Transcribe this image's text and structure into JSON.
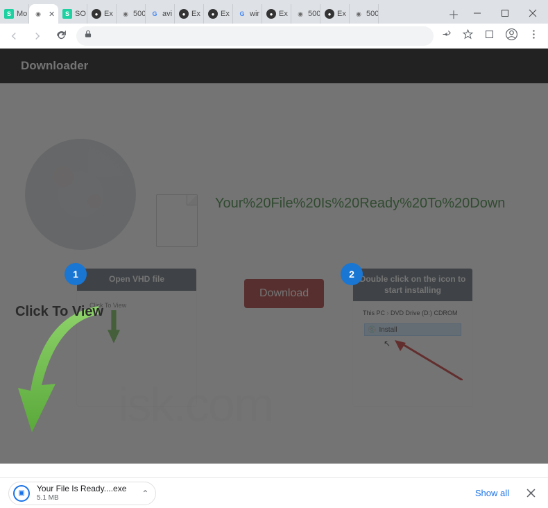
{
  "window": {
    "tabs": [
      {
        "favtype": "s",
        "label": "Mo"
      },
      {
        "favtype": "globe",
        "label": "",
        "active": true
      },
      {
        "favtype": "s",
        "label": "SO"
      },
      {
        "favtype": "ex",
        "label": "Ex"
      },
      {
        "favtype": "globe",
        "label": "500"
      },
      {
        "favtype": "g",
        "label": "avi"
      },
      {
        "favtype": "ex",
        "label": "Ex"
      },
      {
        "favtype": "ex",
        "label": "Ex"
      },
      {
        "favtype": "g",
        "label": "wir"
      },
      {
        "favtype": "ex",
        "label": "Ex"
      },
      {
        "favtype": "globe",
        "label": "500"
      },
      {
        "favtype": "ex",
        "label": "Ex"
      },
      {
        "favtype": "globe",
        "label": "500"
      }
    ]
  },
  "page": {
    "header": "Downloader",
    "headline": "Your%20File%20Is%20Ready%20To%20Down",
    "download_button": "Download",
    "click_to_view": "Click To View",
    "step1": {
      "num": "1",
      "title": "Open VHD file",
      "thumb_text": "Click To View"
    },
    "step2": {
      "num": "2",
      "title": "Double click on the icon to start installing",
      "breadcrumb_a": "This PC",
      "breadcrumb_b": "DVD Drive (D:) CDROM",
      "install_label": "Install"
    },
    "watermark": "isk.com"
  },
  "shelf": {
    "filename": "Your File Is Ready....exe",
    "filesize": "5.1 MB",
    "show_all": "Show all"
  }
}
